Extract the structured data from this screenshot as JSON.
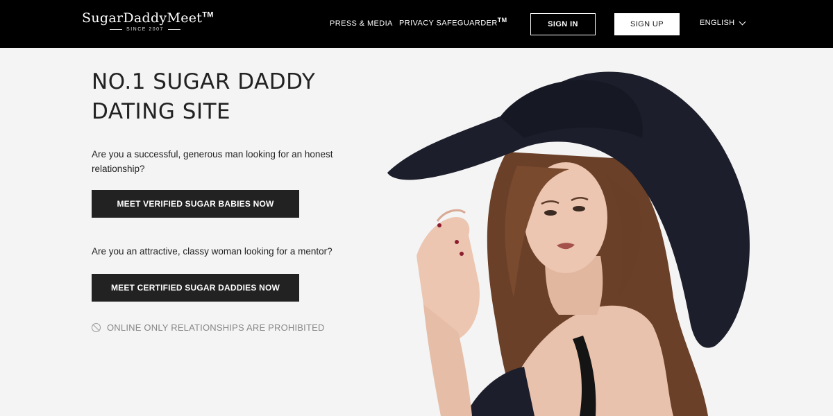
{
  "header": {
    "logo_text": "SugarDaddyMeet",
    "logo_tm": "TM",
    "logo_tagline": "SINCE 2007",
    "nav": {
      "press": "PRESS & MEDIA",
      "privacy": "PRIVACY SAFEGUARDER",
      "privacy_tm": "TM"
    },
    "sign_in": "SIGN IN",
    "sign_up": "SIGN UP",
    "language": "ENGLISH"
  },
  "hero": {
    "title_line1": "NO.1 SUGAR DADDY",
    "title_line2": "DATING SITE",
    "question_men": "Are you a successful, generous man looking for an honest relationship?",
    "cta_men": "MEET VERIFIED SUGAR BABIES NOW",
    "question_women": "Are you an attractive, classy woman looking for a mentor?",
    "cta_women": "MEET CERTIFIED SUGAR DADDIES NOW",
    "notice": "ONLINE ONLY RELATIONSHIPS ARE PROHIBITED"
  },
  "colors": {
    "header_bg": "#000000",
    "page_bg": "#f4f4f4",
    "button_dark": "#222222",
    "hat": "#1c1e2b",
    "hair": "#6b4028",
    "skin": "#e9c2ad"
  },
  "icons": {
    "prohibited": "prohibited-icon",
    "language_dropdown": "chevron-down-icon"
  }
}
